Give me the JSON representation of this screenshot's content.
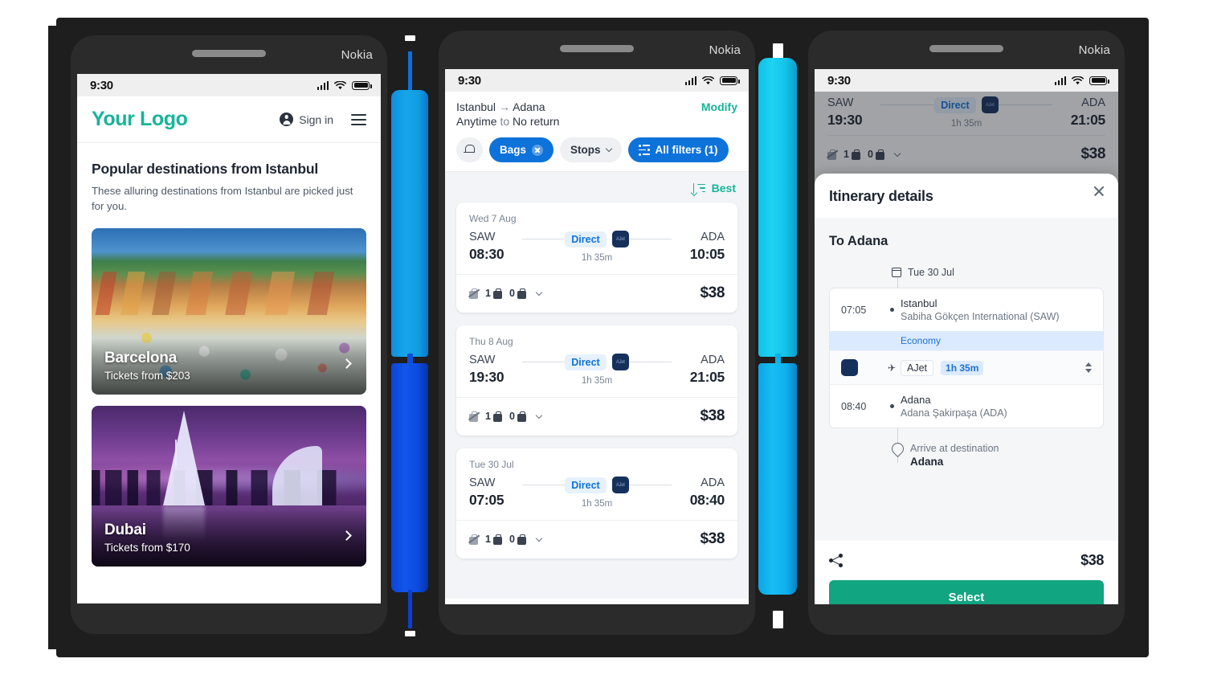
{
  "theme": {
    "brand_green": "#17b598",
    "brand_blue": "#0d72d9",
    "select_green": "#11a581",
    "frame_dark": "#1e1e1e",
    "phone_shell": "#2b2b2b"
  },
  "device": {
    "brand": "Nokia"
  },
  "status_bar": {
    "time": "9:30",
    "signal_icon": "signal-icon",
    "wifi_icon": "wifi-icon",
    "battery_icon": "battery-icon"
  },
  "phone1": {
    "header": {
      "logo": "Your Logo",
      "sign_in": "Sign in",
      "account_icon": "account-circle-icon",
      "menu_icon": "hamburger-menu-icon"
    },
    "section": {
      "title": "Popular destinations from Istanbul",
      "subtitle": "These alluring destinations from Istanbul are picked just for you."
    },
    "destinations": [
      {
        "name": "Barcelona",
        "price_label": "Tickets from $203",
        "arrow_icon": "chevron-right-icon"
      },
      {
        "name": "Dubai",
        "price_label": "Tickets from $170",
        "arrow_icon": "chevron-right-icon"
      }
    ]
  },
  "phone2": {
    "search": {
      "origin": "Istanbul",
      "arrow": "→",
      "destination": "Adana",
      "depart_label": "Anytime",
      "to_word": "to",
      "return_label": "No return",
      "modify": "Modify"
    },
    "filters": {
      "alert_icon": "price-alert-bell-icon",
      "chips": [
        {
          "label": "Bags",
          "active": true,
          "has_clear": true,
          "clear_icon": "clear-circle-icon"
        },
        {
          "label": "Stops",
          "active": false,
          "has_chevron": true,
          "chevron_icon": "chevron-down-icon"
        },
        {
          "label": "All filters (1)",
          "active": true,
          "leading_icon": "sliders-icon"
        }
      ]
    },
    "sort": {
      "icon": "sort-icon",
      "label": "Best"
    },
    "flights": [
      {
        "date": "Wed 7 Aug",
        "origin_code": "SAW",
        "depart_time": "08:30",
        "stops_label": "Direct",
        "duration": "1h 35m",
        "dest_code": "ADA",
        "arrive_time": "10:05",
        "carry_on": "1",
        "checked": "0",
        "price": "$38",
        "no_bag_icon": "no-bag-icon",
        "carry_on_icon": "cabin-bag-icon",
        "checked_icon": "checked-bag-icon",
        "expand_icon": "chevron-down-icon",
        "airline_logo": "ajet-logo"
      },
      {
        "date": "Thu 8 Aug",
        "origin_code": "SAW",
        "depart_time": "19:30",
        "stops_label": "Direct",
        "duration": "1h 35m",
        "dest_code": "ADA",
        "arrive_time": "21:05",
        "carry_on": "1",
        "checked": "0",
        "price": "$38",
        "no_bag_icon": "no-bag-icon",
        "carry_on_icon": "cabin-bag-icon",
        "checked_icon": "checked-bag-icon",
        "expand_icon": "chevron-down-icon",
        "airline_logo": "ajet-logo"
      },
      {
        "date": "Tue 30 Jul",
        "origin_code": "SAW",
        "depart_time": "07:05",
        "stops_label": "Direct",
        "duration": "1h 35m",
        "dest_code": "ADA",
        "arrive_time": "08:40",
        "carry_on": "1",
        "checked": "0",
        "price": "$38",
        "no_bag_icon": "no-bag-icon",
        "carry_on_icon": "cabin-bag-icon",
        "checked_icon": "checked-bag-icon",
        "expand_icon": "chevron-down-icon",
        "airline_logo": "ajet-logo"
      }
    ]
  },
  "phone3": {
    "background_flight": {
      "origin_code": "SAW",
      "depart_time": "19:30",
      "stops_label": "Direct",
      "duration": "1h 35m",
      "dest_code": "ADA",
      "arrive_time": "21:05",
      "carry_on": "1",
      "checked": "0",
      "price": "$38"
    },
    "sheet": {
      "title": "Itinerary details",
      "close_icon": "close-icon",
      "to_city": "To Adana",
      "date": "Tue 30 Jul",
      "calendar_icon": "calendar-icon",
      "departure": {
        "time": "07:05",
        "city": "Istanbul",
        "airport": "Sabiha Gökçen International (SAW)"
      },
      "cabin_class": "Economy",
      "flight": {
        "airline": "AJet",
        "duration": "1h 35m",
        "plane_icon": "plane-icon",
        "expand_icon": "up-down-arrows-icon",
        "airline_logo": "ajet-logo"
      },
      "arrival": {
        "time": "08:40",
        "city": "Adana",
        "airport": "Adana Şakirpaşa (ADA)"
      },
      "destination_note": {
        "label": "Arrive at destination",
        "city": "Adana",
        "pin_icon": "map-pin-icon"
      },
      "footer": {
        "share_icon": "share-icon",
        "price": "$38",
        "select_label": "Select"
      }
    }
  }
}
